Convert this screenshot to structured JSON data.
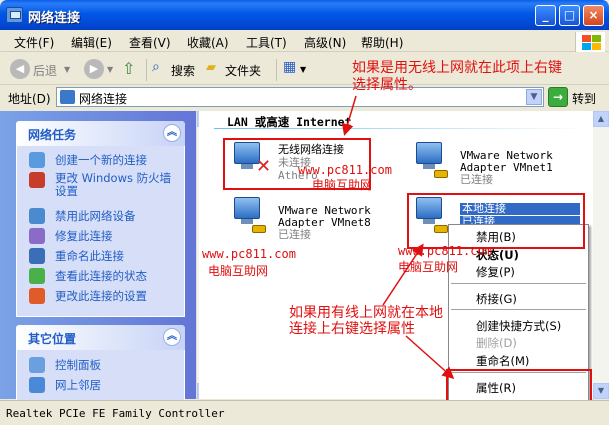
{
  "window": {
    "title": "网络连接"
  },
  "title_buttons": {
    "minimize": "_",
    "maximize": "□",
    "close": "×"
  },
  "menu": [
    "文件(F)",
    "编辑(E)",
    "查看(V)",
    "收藏(A)",
    "工具(T)",
    "高级(N)",
    "帮助(H)"
  ],
  "toolbar": {
    "back": "后退",
    "search": "搜索",
    "folders": "文件夹"
  },
  "address": {
    "label": "地址(D)",
    "value": "网络连接",
    "go": "转到"
  },
  "network_tasks": {
    "title": "网络任务",
    "items": [
      "创建一个新的连接",
      "更改 Windows 防火墙设置",
      "禁用此网络设备",
      "修复此连接",
      "重命名此连接",
      "查看此连接的状态",
      "更改此连接的设置"
    ]
  },
  "other_places": {
    "title": "其它位置",
    "items": [
      "控制面板",
      "网上邻居"
    ]
  },
  "section": {
    "title": "LAN 或高速 Internet"
  },
  "connections": [
    {
      "name": "无线网络连接",
      "status": "未连接",
      "device": "Athero"
    },
    {
      "name": "VMware Network Adapter VMnet1",
      "line1": "VMware Network",
      "line2": "Adapter VMnet1",
      "status": "已连接"
    },
    {
      "name": "VMware Network Adapter VMnet8",
      "line1": "VMware Network",
      "line2": "Adapter VMnet8",
      "status": "已连接"
    },
    {
      "name": "本地连接",
      "status": "已连接"
    }
  ],
  "context_menu": {
    "items": {
      "disable": "禁用(B)",
      "status": "状态(U)",
      "repair": "修复(P)",
      "bridge": "桥接(G)",
      "shortcut": "创建快捷方式(S)",
      "delete": "删除(D)",
      "rename": "重命名(M)",
      "properties": "属性(R)"
    }
  },
  "annotations": {
    "wireless_note_line1": "如果是用无线上网就在此项上右键",
    "wireless_note_line2": "选择属性。",
    "wired_note_line1": "如果用有线上网就在本地",
    "wired_note_line2": "连接上右键选择属性",
    "watermark_url": "www.pc811.com",
    "watermark_name": "电脑互助网"
  },
  "statusbar": {
    "text": "Realtek PCIe FE Family Controller"
  },
  "colors": {
    "annotation": "#e01010",
    "selection": "#316ac5",
    "link": "#215dc6"
  }
}
